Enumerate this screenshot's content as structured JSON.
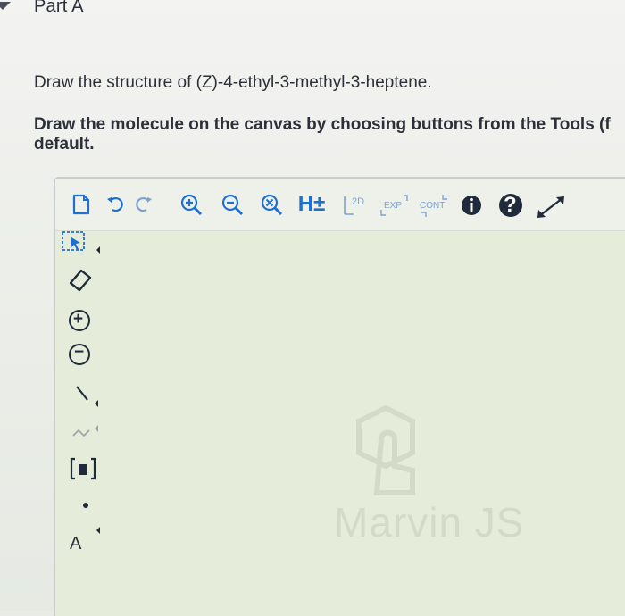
{
  "header": {
    "part_title": "Part A"
  },
  "content": {
    "question": "Draw the structure of (Z)-4-ethyl-3-methyl-3-heptene.",
    "instruction_line1": "Draw the molecule on the canvas by choosing buttons from the Tools (f",
    "instruction_line2": "default."
  },
  "editor": {
    "top_toolbar": {
      "h_label": "H±",
      "two_d_label": "2D",
      "exp_label": "EXP",
      "cont_label": "CONT",
      "help_label": "?"
    },
    "left_toolbar": {
      "plus_label": "+",
      "minus_label": "−",
      "atom_label": "A"
    },
    "watermark_text": "Marvin JS",
    "accent_color": "#1f6fd0",
    "canvas_color": "#e5ecd9"
  }
}
